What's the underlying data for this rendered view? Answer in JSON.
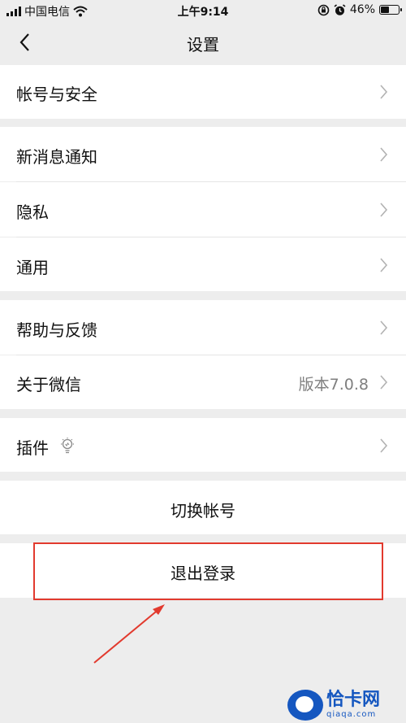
{
  "status_bar": {
    "carrier": "中国电信",
    "time": "上午9:14",
    "battery_percent": "46%",
    "battery_level": 0.46,
    "icons": [
      "signal-icon",
      "wifi-icon",
      "rotation-lock-icon",
      "alarm-icon",
      "battery-icon"
    ]
  },
  "nav": {
    "title": "设置",
    "back_icon": "chevron-left-icon"
  },
  "settings": {
    "account_security": "帐号与安全",
    "new_message_notification": "新消息通知",
    "privacy": "隐私",
    "general": "通用",
    "help_feedback": "帮助与反馈",
    "about_wechat": "关于微信",
    "version": "版本7.0.8",
    "plugins": "插件",
    "switch_account": "切换帐号",
    "logout": "退出登录"
  },
  "annotation": {
    "highlight_color": "#e23a2e"
  },
  "watermark": {
    "name": "恰卡网",
    "url": "qiaqa.com"
  }
}
